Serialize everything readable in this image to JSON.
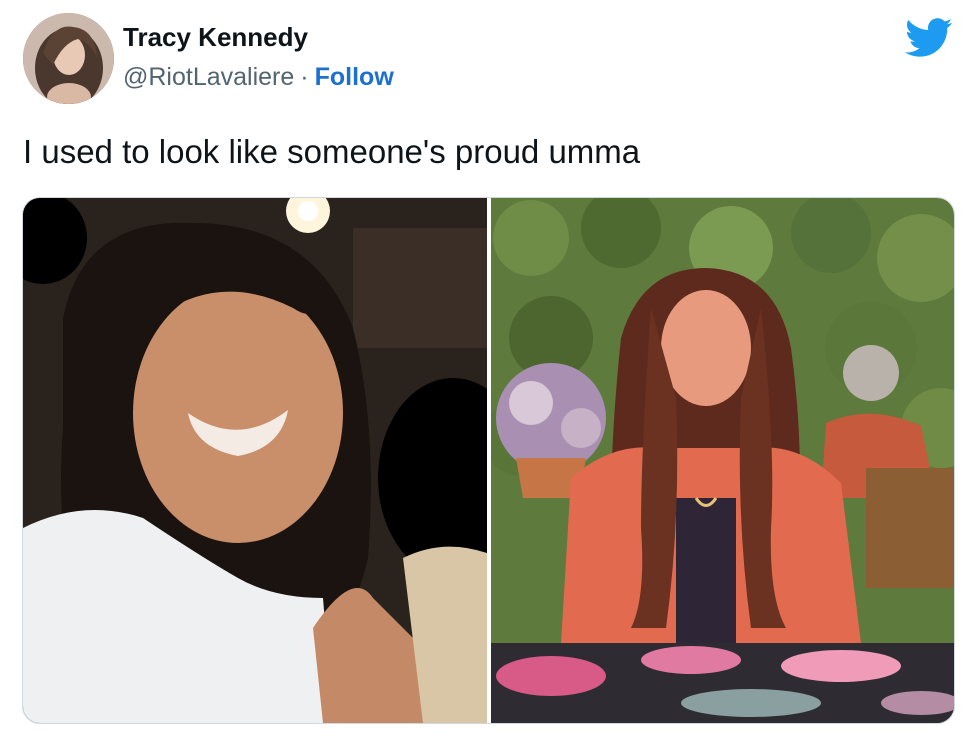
{
  "author": {
    "name": "Tracy Kennedy",
    "handle": "@RiotLavaliere",
    "separator": "·",
    "follow_label": "Follow"
  },
  "tweet": {
    "text": "I used to look like someone's proud umma"
  },
  "icons": {
    "brand": "twitter-bird-icon"
  },
  "colors": {
    "follow": "#1d6fd4",
    "twitter_blue": "#1d9bf0",
    "muted_text": "#536471",
    "text": "#0f1419",
    "media_border": "#cfd9de"
  }
}
